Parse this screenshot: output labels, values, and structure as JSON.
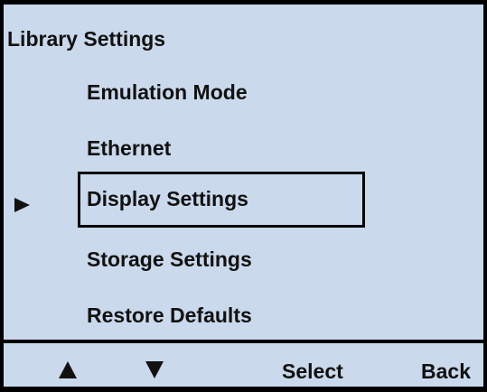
{
  "screen": {
    "title": "Library Settings"
  },
  "menu": {
    "items": [
      {
        "label": "Emulation Mode"
      },
      {
        "label": "Ethernet"
      },
      {
        "label": "Display Settings",
        "selected": true
      },
      {
        "label": "Storage Settings"
      },
      {
        "label": "Restore Defaults"
      }
    ],
    "pointer_icon": "right-triangle-pointer"
  },
  "softkeys": {
    "up_icon": "up-arrow-triangle",
    "down_icon": "down-arrow-triangle",
    "select_label": "Select",
    "back_label": "Back"
  },
  "colors": {
    "background": "#cbd9ec",
    "foreground": "#111111",
    "border": "#000000"
  }
}
